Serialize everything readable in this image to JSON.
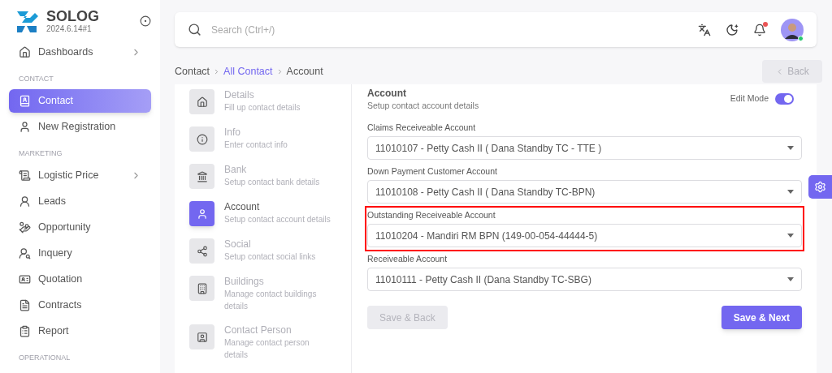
{
  "brand": {
    "name": "SOLOG",
    "version": "2024.6.14#1"
  },
  "sidebar": [
    {
      "kind": "item",
      "label": "Dashboards",
      "selected": false,
      "has_submenu": true
    },
    {
      "kind": "section",
      "label": "CONTACT"
    },
    {
      "kind": "item",
      "label": "Contact",
      "selected": true,
      "has_submenu": false
    },
    {
      "kind": "item",
      "label": "New Registration",
      "selected": false,
      "has_submenu": false
    },
    {
      "kind": "section",
      "label": "MARKETING"
    },
    {
      "kind": "item",
      "label": "Logistic Price",
      "selected": false,
      "has_submenu": true
    },
    {
      "kind": "item",
      "label": "Leads",
      "selected": false,
      "has_submenu": false
    },
    {
      "kind": "item",
      "label": "Opportunity",
      "selected": false,
      "has_submenu": false
    },
    {
      "kind": "item",
      "label": "Inquery",
      "selected": false,
      "has_submenu": false
    },
    {
      "kind": "item",
      "label": "Quotation",
      "selected": false,
      "has_submenu": false
    },
    {
      "kind": "item",
      "label": "Contracts",
      "selected": false,
      "has_submenu": false
    },
    {
      "kind": "item",
      "label": "Report",
      "selected": false,
      "has_submenu": false
    },
    {
      "kind": "section",
      "label": "OPERATIONAL"
    }
  ],
  "search": {
    "placeholder": "Search (Ctrl+/)"
  },
  "topbar": {
    "notifications_unread": true,
    "user_online": true
  },
  "breadcrumb": [
    {
      "label": "Contact",
      "link": false
    },
    {
      "label": "All Contact",
      "link": true
    },
    {
      "label": "Account",
      "link": false
    }
  ],
  "back_button": {
    "label": "Back",
    "disabled": true
  },
  "steps": [
    {
      "title": "Details",
      "subtitle": "Fill up contact details",
      "selected": false
    },
    {
      "title": "Info",
      "subtitle": "Enter contact info",
      "selected": false
    },
    {
      "title": "Bank",
      "subtitle": "Setup contact bank details",
      "selected": false
    },
    {
      "title": "Account",
      "subtitle": "Setup contact account details",
      "selected": true
    },
    {
      "title": "Social",
      "subtitle": "Setup contact social links",
      "selected": false
    },
    {
      "title": "Buildings",
      "subtitle": "Manage contact buildings details",
      "selected": false
    },
    {
      "title": "Contact Person",
      "subtitle": "Manage contact person details",
      "selected": false
    }
  ],
  "form": {
    "title": "Account",
    "subtitle": "Setup contact account details",
    "edit_mode": {
      "label": "Edit Mode",
      "on": true
    },
    "fields": [
      {
        "label": "Claims Receiveable Account",
        "value": "11010107 - Petty Cash II ( Dana Standby TC - TTE )",
        "highlighted": false
      },
      {
        "label": "Down Payment Customer Account",
        "value": "11010108 - Petty Cash II ( Dana Standby TC-BPN)",
        "highlighted": false
      },
      {
        "label": "Outstanding Receiveable Account",
        "value": "11010204 - Mandiri RM BPN (149-00-054-44444-5)",
        "highlighted": true
      },
      {
        "label": "Receiveable Account",
        "value": "11010111 - Petty Cash II (Dana Standby TC-SBG)",
        "highlighted": false
      }
    ],
    "buttons": [
      {
        "label": "Save & Back",
        "kind": "secondary",
        "disabled": true
      },
      {
        "label": "Save & Next",
        "kind": "primary",
        "disabled": false
      }
    ]
  }
}
